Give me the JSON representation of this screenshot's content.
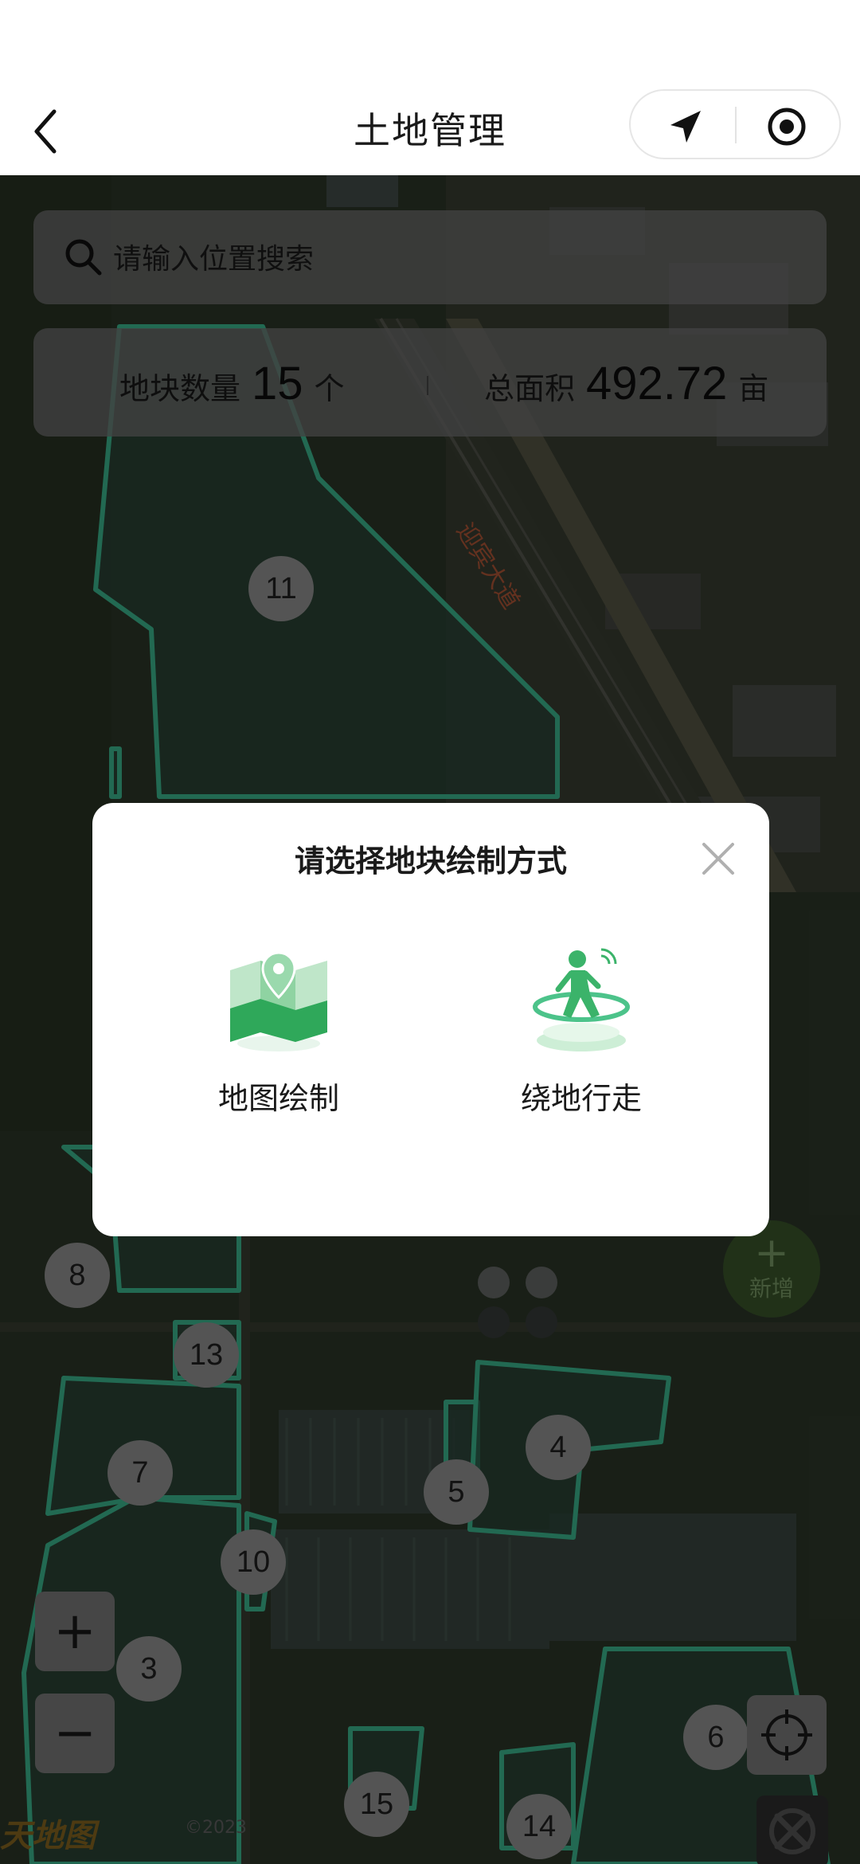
{
  "header": {
    "title": "土地管理"
  },
  "search": {
    "placeholder": "请输入位置搜索"
  },
  "stats": {
    "count_label": "地块数量",
    "count_value": "15",
    "count_unit": "个",
    "area_label": "总面积",
    "area_value": "492.72",
    "area_unit": "亩"
  },
  "map": {
    "road_label": "迎宾大道",
    "plot_numbers": [
      "11",
      "8",
      "13",
      "7",
      "10",
      "3",
      "5",
      "4",
      "6",
      "15",
      "14"
    ],
    "add_button": {
      "plus": "+",
      "label": "新增"
    },
    "zoom_in": "+",
    "zoom_out": "−",
    "logo": "天地图",
    "copyright": "©2023"
  },
  "modal": {
    "title": "请选择地块绘制方式",
    "options": [
      {
        "label": "地图绘制",
        "icon": "map-pin-icon"
      },
      {
        "label": "绕地行走",
        "icon": "walking-person-icon"
      }
    ]
  },
  "colors": {
    "accent_green": "#4cc38a",
    "plot_border": "#3fbf95",
    "modal_bg": "#ffffff"
  }
}
